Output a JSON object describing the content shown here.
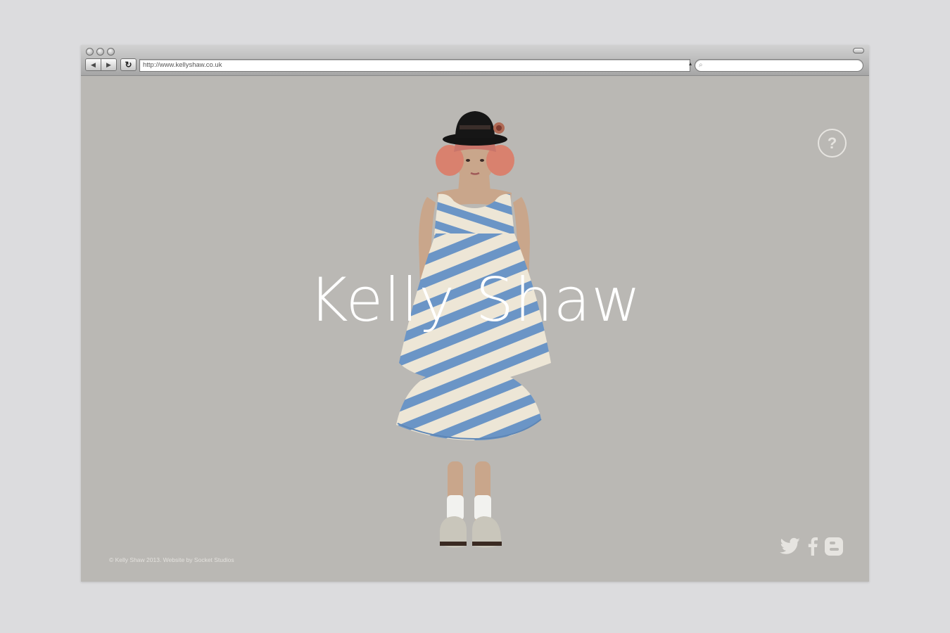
{
  "browser": {
    "url": "http://www.kellyshaw.co.uk",
    "nav_back_glyph": "◀",
    "nav_forward_glyph": "▶",
    "reload_glyph": "↻",
    "search_placeholder": ""
  },
  "page": {
    "title": "Kelly Shaw",
    "help_label": "?",
    "footer": "© Kelly Shaw 2013. Website by Socket Studios",
    "social": [
      "twitter-icon",
      "facebook-icon",
      "blogger-icon"
    ]
  },
  "colors": {
    "page_background": "#bab8b4",
    "title": "#ffffff",
    "dress_blue": "#6b95c6",
    "dress_cream": "#ede6d6"
  }
}
